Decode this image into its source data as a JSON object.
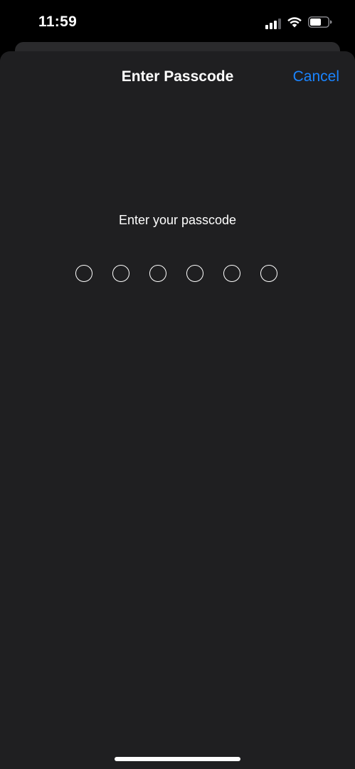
{
  "status_bar": {
    "time": "11:59",
    "icons": [
      "cellular-signal-icon",
      "wifi-icon",
      "battery-icon"
    ]
  },
  "sheet": {
    "title": "Enter Passcode",
    "cancel_label": "Cancel",
    "prompt": "Enter your passcode",
    "passcode_length": 6,
    "digits_entered": 0
  },
  "colors": {
    "background": "#1f1f21",
    "accent": "#1a84ff",
    "text": "#ffffff"
  }
}
